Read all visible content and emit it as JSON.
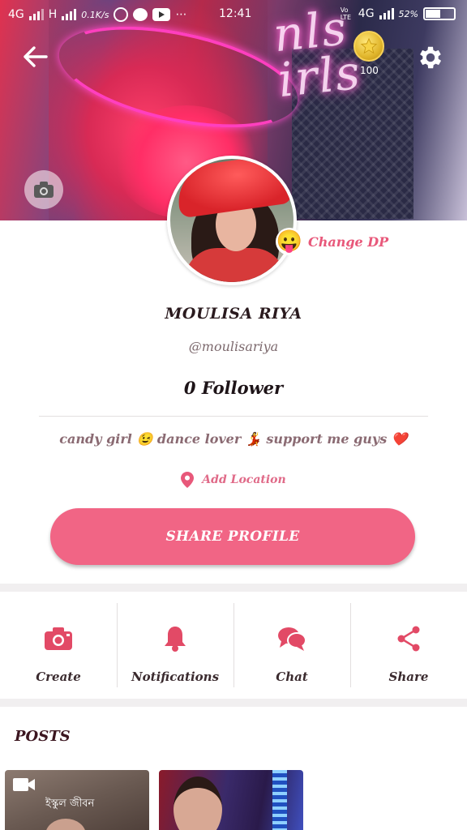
{
  "status_bar": {
    "network_left": "4G",
    "network_h": "H",
    "speed": "0.1K/s",
    "time": "12:41",
    "network_right": "4G",
    "volte": "Vo LTE",
    "battery": "52%"
  },
  "cover": {
    "neon_text_line1": "nls",
    "neon_text_line2": "irls",
    "medal_count": "100"
  },
  "profile": {
    "change_dp": "Change DP",
    "name": "MOULISA RIYA",
    "username": "@moulisariya",
    "followers": "0 Follower",
    "bio": "candy girl 😉 dance lover 💃 support me guys ❤️",
    "add_location": "Add Location",
    "share_profile": "SHARE PROFILE"
  },
  "actions": [
    {
      "label": "Create",
      "icon": "camera-icon"
    },
    {
      "label": "Notifications",
      "icon": "bell-icon"
    },
    {
      "label": "Chat",
      "icon": "chat-bubbles-icon"
    },
    {
      "label": "Share",
      "icon": "share-icon"
    }
  ],
  "posts": {
    "title": "POSTS",
    "items": [
      {
        "caption": "ইস্কুল জীবন",
        "type": "video"
      },
      {
        "caption": "",
        "type": "image"
      }
    ]
  },
  "colors": {
    "accent": "#f16585",
    "accent_text": "#e8587a",
    "dark_text": "#2a1a1e"
  }
}
